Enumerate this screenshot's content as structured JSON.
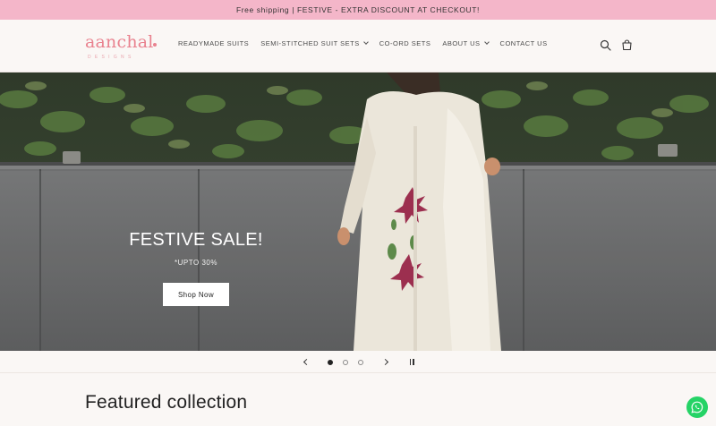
{
  "announcement": {
    "text": "Free shipping | FESTIVE - EXTRA DISCOUNT AT CHECKOUT!"
  },
  "header": {
    "logo": {
      "main": "aanchal",
      "sub": "DESIGNS"
    },
    "nav": [
      {
        "label": "READYMADE SUITS",
        "has_dropdown": false
      },
      {
        "label": "SEMI-STITCHED SUIT SETS",
        "has_dropdown": true
      },
      {
        "label": "CO-ORD SETS",
        "has_dropdown": false
      },
      {
        "label": "ABOUT US",
        "has_dropdown": true
      },
      {
        "label": "CONTACT US",
        "has_dropdown": false
      }
    ],
    "icons": {
      "search": "search-icon",
      "cart": "cart-icon"
    }
  },
  "hero": {
    "title": "FESTIVE SALE!",
    "subtitle": "*UPTO 30%",
    "button_label": "Shop Now"
  },
  "slider": {
    "slides": 3,
    "active_index": 0,
    "icons": {
      "prev": "chevron-left-icon",
      "next": "chevron-right-icon",
      "pause": "pause-icon"
    }
  },
  "featured": {
    "heading": "Featured collection"
  },
  "floating": {
    "whatsapp_icon": "whatsapp-icon"
  },
  "colors": {
    "announcement_bg": "#f4b6c9",
    "brand_pink": "#e9828f",
    "page_bg": "#faf7f5",
    "whatsapp_green": "#25d366"
  }
}
